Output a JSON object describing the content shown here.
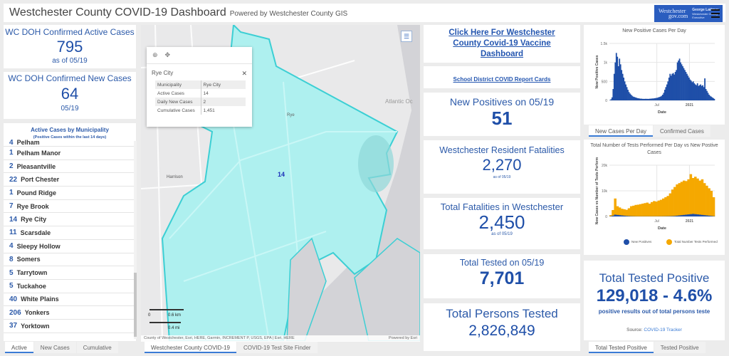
{
  "header": {
    "title": "Westchester County COVID-19 Dashboard",
    "subtitle": "Powered by Westchester County GIS",
    "logo_text_1": "Westchester",
    "logo_text_2": "gov.com",
    "logo_text_3": "George Latimer",
    "logo_text_4": "Westchester County Executive"
  },
  "left": {
    "active_cases": {
      "title": "WC DOH Confirmed Active Cases",
      "value": "795",
      "sub": "as of 05/19"
    },
    "new_cases": {
      "title": "WC DOH Confirmed New Cases",
      "value": "64",
      "sub": "05/19"
    },
    "municipality": {
      "title": "Active Cases by Municipality",
      "subtitle": "(Positive Cases within the last 14 days)",
      "items": [
        {
          "count": "4",
          "name": "Pelham"
        },
        {
          "count": "1",
          "name": "Pelham Manor"
        },
        {
          "count": "2",
          "name": "Pleasantville"
        },
        {
          "count": "22",
          "name": "Port Chester"
        },
        {
          "count": "1",
          "name": "Pound Ridge"
        },
        {
          "count": "7",
          "name": "Rye Brook"
        },
        {
          "count": "14",
          "name": "Rye City"
        },
        {
          "count": "11",
          "name": "Scarsdale"
        },
        {
          "count": "4",
          "name": "Sleepy Hollow"
        },
        {
          "count": "8",
          "name": "Somers"
        },
        {
          "count": "5",
          "name": "Tarrytown"
        },
        {
          "count": "5",
          "name": "Tuckahoe"
        },
        {
          "count": "40",
          "name": "White Plains"
        },
        {
          "count": "206",
          "name": "Yonkers"
        },
        {
          "count": "37",
          "name": "Yorktown"
        }
      ]
    },
    "tabs": [
      "Active",
      "New Cases",
      "Cumulative"
    ]
  },
  "map": {
    "popup": {
      "title": "Rye City",
      "rows": [
        {
          "k": "Municipality",
          "v": "Rye City"
        },
        {
          "k": "Active Cases",
          "v": "14"
        },
        {
          "k": "Daily New Cases",
          "v": "2"
        },
        {
          "k": "Cumulative Cases",
          "v": "1,451"
        }
      ]
    },
    "labels": {
      "rye": "Rye",
      "harrison": "Harrison",
      "ocean": "Atlantic Oc",
      "count": "14"
    },
    "scale": {
      "km": "0.6 km",
      "mi": "0.4 mi",
      "zero": "0"
    },
    "attribution": "County of Westchester, Esri, HERE, Garmin, INCREMENT P, USGS, EPA | Esri, HERE",
    "powered": "Powered by Esri",
    "tabs": [
      "Westchester County COVID-19",
      "COVID-19 Test Site Finder"
    ]
  },
  "middle": {
    "vaccine_link": "Click Here For Westchester County Covid-19 Vaccine Dashboard",
    "school_link": "School District COVID Report Cards",
    "new_positives": {
      "title": "New Positives on 05/19",
      "value": "51"
    },
    "resident_fatalities": {
      "title": "Westchester Resident Fatalities",
      "value": "2,270",
      "sub": "as of 05/19"
    },
    "total_fatalities": {
      "title": "Total Fatalities in Westchester",
      "value": "2,450",
      "sub": "as of 05/19"
    },
    "tested_today": {
      "title": "Total Tested on 05/19",
      "value": "7,701"
    },
    "persons_tested": {
      "title": "Total Persons Tested",
      "value": "2,826,849"
    }
  },
  "right": {
    "chart1_tabs": [
      "New Cases Per Day",
      "Confirmed Cases"
    ],
    "total_positive": {
      "title": "Total Tested Positive",
      "value": "129,018 - 4.6%",
      "sub": "positive results out of total persons teste",
      "source_label": "Source:",
      "source_link": "COVID-19 Tracker"
    },
    "bottom_tabs": [
      "Total Tested Positive",
      "Tested Positive"
    ]
  },
  "chart_data": [
    {
      "type": "bar",
      "title": "New Positive Cases Per Day",
      "xlabel": "Date",
      "ylabel": "New Positive Cases",
      "ylim": [
        0,
        1500
      ],
      "yticks": [
        "0",
        "500",
        "1k",
        "1.5k"
      ],
      "xticks": [
        "Jul",
        "2021"
      ],
      "series": [
        {
          "name": "New Positive Cases",
          "color": "#1f4fa8",
          "values": [
            10,
            30,
            80,
            300,
            700,
            1000,
            1250,
            1150,
            900,
            1100,
            950,
            800,
            700,
            600,
            500,
            420,
            350,
            280,
            220,
            180,
            150,
            120,
            100,
            90,
            80,
            70,
            60,
            55,
            50,
            45,
            45,
            40,
            40,
            40,
            42,
            40,
            40,
            40,
            45,
            45,
            50,
            50,
            55,
            60,
            65,
            70,
            80,
            90,
            100,
            120,
            150,
            200,
            280,
            350,
            420,
            500,
            600,
            700,
            650,
            700,
            720,
            680,
            750,
            800,
            1000,
            1050,
            1100,
            1000,
            950,
            900,
            850,
            800,
            750,
            700,
            650,
            600,
            550,
            520,
            480,
            500,
            450,
            420,
            400,
            450,
            380,
            400,
            420,
            380,
            400,
            350,
            580,
            300,
            250,
            200,
            150,
            120,
            100,
            80,
            60,
            40
          ]
        }
      ]
    },
    {
      "type": "area",
      "title": "Total Number of Tests Performed Per Day vs New Postive Cases",
      "xlabel": "Date",
      "ylabel": "New Cases vs Number of Tests Perform",
      "ylim": [
        0,
        20000
      ],
      "yticks": [
        "0",
        "10k",
        "20k"
      ],
      "xticks": [
        "Jul",
        "2021"
      ],
      "legend": "bottom",
      "series": [
        {
          "name": "New Positives",
          "color": "#1f4fa8",
          "values": [
            100,
            300,
            700,
            600,
            500,
            400,
            300,
            200,
            150,
            100,
            80,
            60,
            50,
            50,
            50,
            50,
            50,
            50,
            50,
            50,
            50,
            60,
            60,
            70,
            80,
            100,
            120,
            150,
            200,
            300,
            400,
            500,
            600,
            700,
            800,
            900,
            1000,
            900,
            800,
            700,
            600,
            500,
            400,
            300,
            200,
            100
          ]
        },
        {
          "name": "Total Number Tests Performed",
          "color": "#f5a800",
          "values": [
            500,
            2500,
            7000,
            4000,
            3500,
            3000,
            2800,
            2600,
            3200,
            4000,
            4200,
            4500,
            4600,
            4800,
            5000,
            5200,
            5400,
            5000,
            5600,
            6000,
            5800,
            6200,
            6500,
            7000,
            7500,
            8000,
            9000,
            10500,
            11500,
            12500,
            13000,
            13500,
            14000,
            13800,
            14500,
            16500,
            15000,
            15500,
            14800,
            14000,
            14500,
            13000,
            12000,
            11000,
            10000,
            7500
          ]
        }
      ]
    }
  ]
}
